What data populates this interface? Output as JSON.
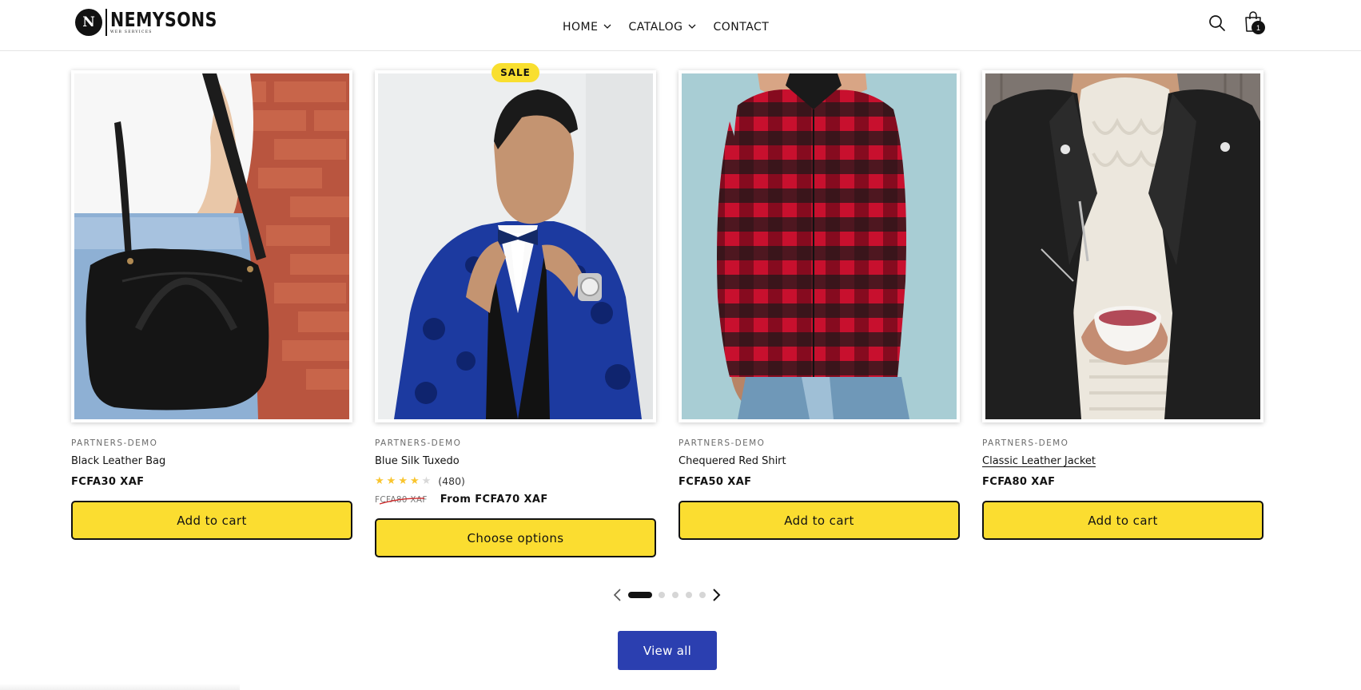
{
  "header": {
    "logo_mark": "N",
    "logo_name": "NEMYSONS",
    "logo_sub": "WEB SERVICES",
    "nav": [
      {
        "label": "HOME",
        "has_dropdown": true
      },
      {
        "label": "CATALOG",
        "has_dropdown": true
      },
      {
        "label": "CONTACT",
        "has_dropdown": false
      }
    ],
    "cart_count": "1",
    "icons": [
      "search-icon",
      "cart-icon"
    ]
  },
  "products": [
    {
      "vendor": "PARTNERS-DEMO",
      "title": "Black Leather Bag",
      "price": "FCFA30 XAF",
      "button": "Add to cart",
      "image": "woman-with-black-leather-bag"
    },
    {
      "vendor": "PARTNERS-DEMO",
      "title": "Blue Silk Tuxedo",
      "badge": "SALE",
      "rating": {
        "stars": 4,
        "max": 5,
        "count": "(480)"
      },
      "price_old": "FCFA80 XAF",
      "price": "From FCFA70 XAF",
      "button": "Choose options",
      "image": "man-in-blue-silk-tuxedo"
    },
    {
      "vendor": "PARTNERS-DEMO",
      "title": "Chequered Red Shirt",
      "price": "FCFA50 XAF",
      "button": "Add to cart",
      "image": "man-in-red-plaid-shirt"
    },
    {
      "vendor": "PARTNERS-DEMO",
      "title": "Classic Leather Jacket",
      "price": "FCFA80 XAF",
      "button": "Add to cart",
      "image": "woman-in-leather-jacket-holding-tea"
    }
  ],
  "slider": {
    "current": 1,
    "total": 5
  },
  "view_all": "View all",
  "colors": {
    "button_yellow": "#fbdd30",
    "sale_badge": "#f9df2f",
    "view_all_blue": "#2b3fb0",
    "star": "#f9c52f",
    "text": "#121212"
  }
}
